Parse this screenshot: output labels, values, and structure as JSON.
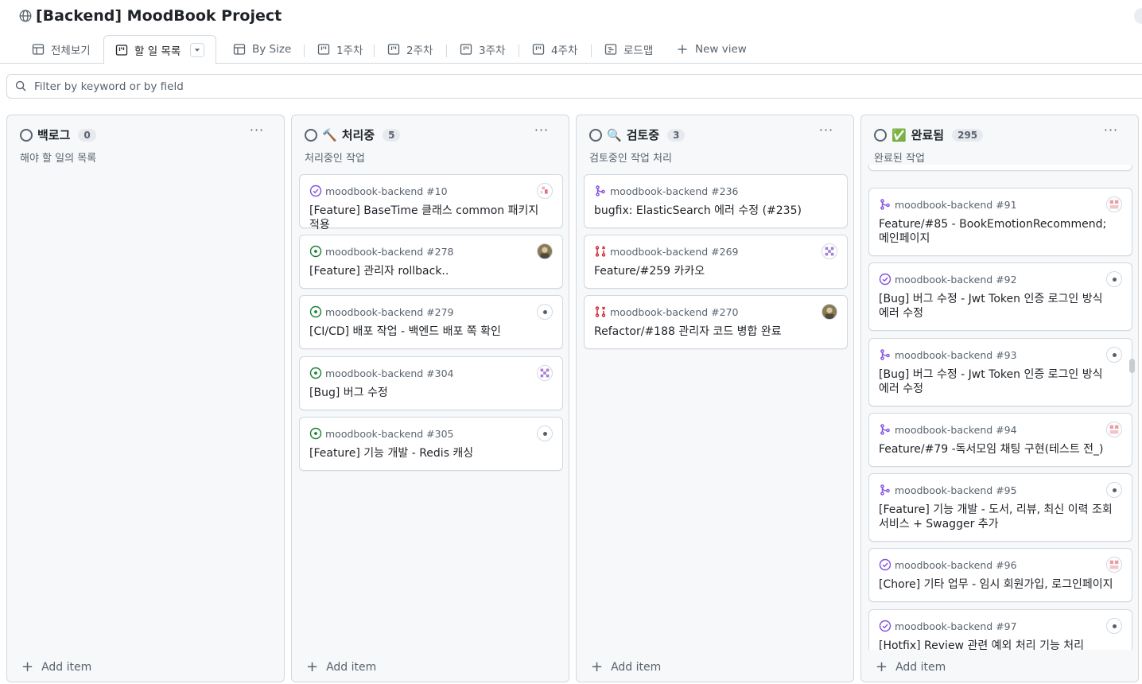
{
  "project": {
    "title": "[Backend] MoodBook Project"
  },
  "tabs": [
    {
      "label": "전체보기",
      "icon": "table-icon"
    },
    {
      "label": "할 일 목록",
      "icon": "board-icon",
      "active": true
    },
    {
      "label": "By Size",
      "icon": "table-icon"
    },
    {
      "label": "1주차",
      "icon": "board-icon"
    },
    {
      "label": "2주차",
      "icon": "board-icon"
    },
    {
      "label": "3주차",
      "icon": "board-icon"
    },
    {
      "label": "4주차",
      "icon": "board-icon"
    },
    {
      "label": "로드맵",
      "icon": "roadmap-icon"
    },
    {
      "label": "New view",
      "icon": "plus-icon"
    }
  ],
  "filter": {
    "placeholder": "Filter by keyword or by field"
  },
  "colors": {
    "accent_green": "#1a7f37",
    "accent_purple": "#8250df",
    "accent_red": "#cf222e",
    "border": "#d1d9e0"
  },
  "columns": [
    {
      "title": "백로그",
      "emoji": "",
      "count": "0",
      "description": "해야 할 일의 목록",
      "add_label": "Add item",
      "cards": []
    },
    {
      "title": "처리중",
      "emoji": "🔨",
      "count": "5",
      "description": "처리중인 작업",
      "add_label": "Add item",
      "cards": [
        {
          "repo": "moodbook-backend #10",
          "title": "[Feature] BaseTime 클래스 common 패키지 적용",
          "status": "closed-issue",
          "avatar": "pixel-avatar"
        },
        {
          "repo": "moodbook-backend #278",
          "title": "[Feature] 관리자 rollback..",
          "status": "open-issue",
          "avatar": "photo-avatar"
        },
        {
          "repo": "moodbook-backend #279",
          "title": "[CI/CD] 배포 작업 - 백엔드 배포 쪽 확인",
          "status": "open-issue",
          "avatar": "default-avatar"
        },
        {
          "repo": "moodbook-backend #304",
          "title": "[Bug] 버그 수정",
          "status": "open-issue",
          "avatar": "identicon-avatar"
        },
        {
          "repo": "moodbook-backend #305",
          "title": "[Feature] 기능 개발 - Redis 캐싱",
          "status": "open-issue",
          "avatar": "default-avatar"
        }
      ]
    },
    {
      "title": "검토중",
      "emoji": "🔍",
      "count": "3",
      "description": "검토중인 작업 처리",
      "add_label": "Add item",
      "cards": [
        {
          "repo": "moodbook-backend #236",
          "title": "bugfix: ElasticSearch 에러 수정 (#235)",
          "status": "merged-pr",
          "avatar": ""
        },
        {
          "repo": "moodbook-backend #269",
          "title": "Feature/#259 카카오",
          "status": "closed-pr",
          "avatar": "identicon-avatar"
        },
        {
          "repo": "moodbook-backend #270",
          "title": "Refactor/#188 관리자 코드 병합 완료",
          "status": "closed-pr",
          "avatar": "photo-avatar"
        }
      ]
    },
    {
      "title": "완료됨",
      "emoji": "✅",
      "count": "295",
      "description": "완료된 작업",
      "add_label": "Add item",
      "cards": [
        {
          "repo": "moodbook-backend #91",
          "title": "Feature/#85 - BookEmotionRecommend; 메인페이지",
          "status": "merged-pr",
          "avatar": "pixel-avatar"
        },
        {
          "repo": "moodbook-backend #92",
          "title": "[Bug] 버그 수정 - Jwt Token 인증 로그인 방식 에러 수정",
          "status": "closed-issue",
          "avatar": "default-avatar"
        },
        {
          "repo": "moodbook-backend #93",
          "title": "[Bug] 버그 수정 - Jwt Token 인증 로그인 방식 에러 수정",
          "status": "merged-pr",
          "avatar": "default-avatar"
        },
        {
          "repo": "moodbook-backend #94",
          "title": "Feature/#79 -독서모임 채팅 구현(테스트 전_)",
          "status": "merged-pr",
          "avatar": "pixel-avatar"
        },
        {
          "repo": "moodbook-backend #95",
          "title": "[Feature] 기능 개발 - 도서, 리뷰, 최신 이력 조회 서비스 + Swagger 추가",
          "status": "merged-pr",
          "avatar": "default-avatar"
        },
        {
          "repo": "moodbook-backend #96",
          "title": "[Chore] 기타 업무 - 임시 회원가입, 로그인페이지",
          "status": "closed-issue",
          "avatar": "pixel-avatar"
        },
        {
          "repo": "moodbook-backend #97",
          "title": "[Hotfix] Review 관련 예외 처리 기능 처리",
          "status": "closed-issue",
          "avatar": "default-avatar"
        }
      ]
    }
  ]
}
